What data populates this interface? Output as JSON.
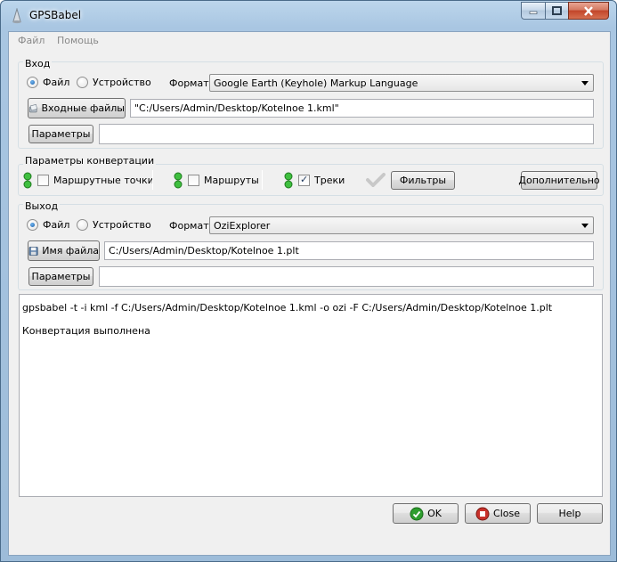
{
  "window": {
    "title": "GPSBabel"
  },
  "menu": {
    "file": "Файл",
    "help": "Помощь"
  },
  "input": {
    "group_title": "Вход",
    "radio_file": "Файл",
    "radio_device": "Устройство",
    "format_label": "Формат",
    "format_value": "Google Earth (Keyhole) Markup Language",
    "files_button": "Входные файлы",
    "files_value": "\"C:/Users/Admin/Desktop/Kotelnoe 1.kml\"",
    "params_button": "Параметры",
    "params_value": ""
  },
  "conversion": {
    "group_title": "Параметры конвертации",
    "waypoints": "Маршрутные точки",
    "routes": "Маршруты",
    "tracks": "Треки",
    "filters_button": "Фильтры",
    "advanced_button": "Дополнительно",
    "waypoints_checked": false,
    "routes_checked": false,
    "tracks_checked": true
  },
  "output": {
    "group_title": "Выход",
    "radio_file": "Файл",
    "radio_device": "Устройство",
    "format_label": "Формат",
    "format_value": "OziExplorer",
    "filename_button": "Имя файла",
    "filename_value": "C:/Users/Admin/Desktop/Kotelnoe 1.plt",
    "params_button": "Параметры",
    "params_value": ""
  },
  "log": {
    "line1": "gpsbabel -t -i kml -f C:/Users/Admin/Desktop/Kotelnoe 1.kml -o ozi -F C:/Users/Admin/Desktop/Kotelnoe 1.plt",
    "line2": "Конвертация выполнена"
  },
  "buttons": {
    "ok": "OK",
    "close": "Close",
    "help": "Help"
  },
  "colors": {
    "accent_blue": "#1b5fa8",
    "ok_green": "#2e9e2e",
    "close_red": "#c8302a",
    "led_green": "#3fbf3f"
  }
}
